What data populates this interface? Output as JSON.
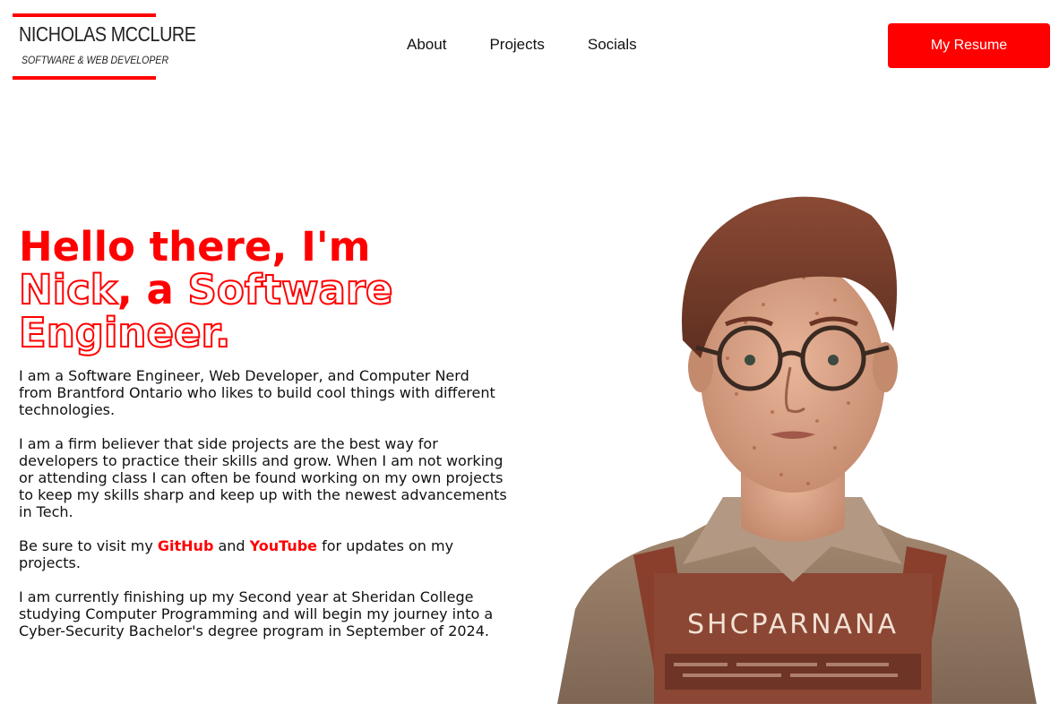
{
  "header": {
    "logo": {
      "name": "NICHOLAS MCCLURE",
      "tagline": "SOFTWARE & WEB DEVELOPER"
    },
    "nav": [
      "About",
      "Projects",
      "Socials"
    ],
    "resume_label": "My Resume",
    "accent_color": "#ff0000"
  },
  "hero": {
    "headline": {
      "line1": "Hello there, I'm",
      "nick": "Nick",
      "comma_a": ", a ",
      "software": "Software",
      "engineer": "Engineer."
    },
    "bio": {
      "p1": "I am a Software Engineer, Web Developer, and Computer Nerd from Brantford Ontario who likes to build cool things with different technologies.",
      "p2": "I am a firm believer that side projects are the best way for developers to practice their skills and grow. When I am not working or attending class I can often be found working on my own projects to keep my skills sharp and keep up with the newest advancements in Tech.",
      "p3_prefix": "Be sure to visit my ",
      "github": "GitHub",
      "p3_and": " and ",
      "youtube": "YouTube",
      "p3_suffix": " for updates on my projects.",
      "p4": "I am currently finishing up my Second year at Sheridan College studying Computer Programming and will begin my journey into a Cyber-Security Bachelor's degree program in September of 2024."
    },
    "portrait": {
      "badge_text": "SHCPARNANA"
    }
  }
}
